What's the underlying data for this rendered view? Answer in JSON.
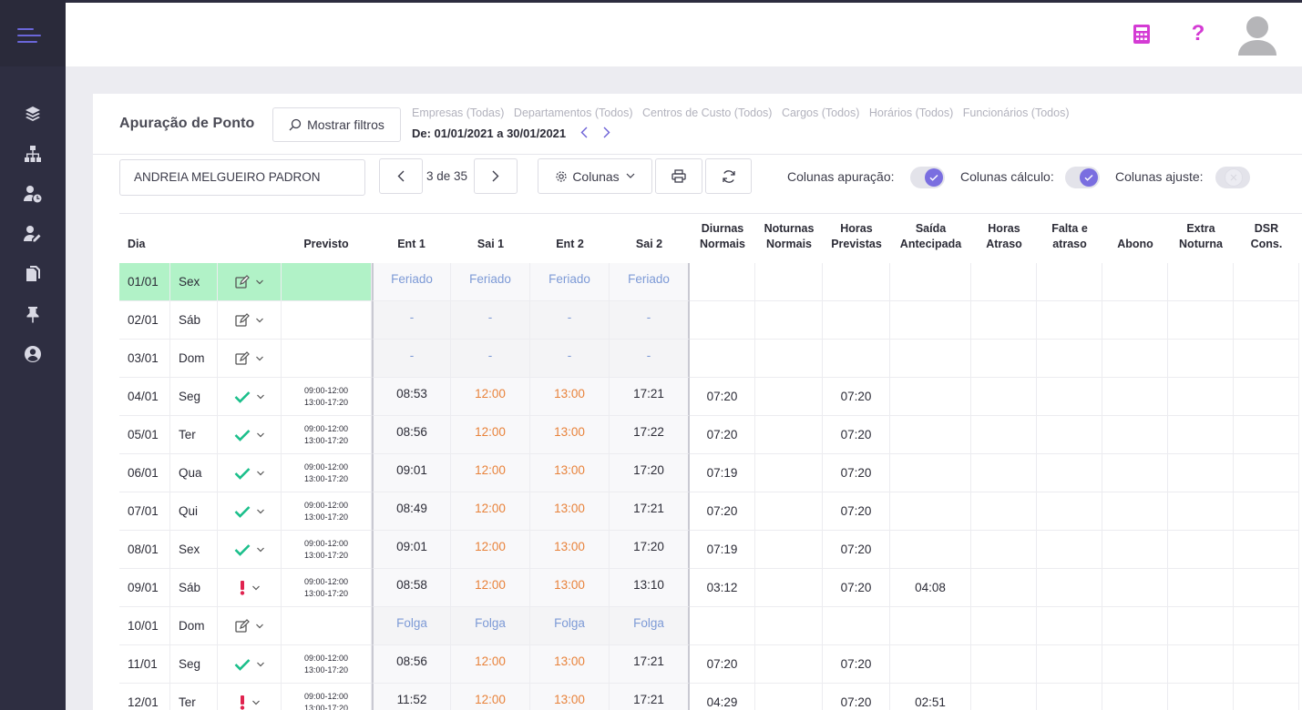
{
  "header": {
    "calculator_icon_color": "#d43bd4",
    "help_icon_color": "#d43bd4",
    "help_label": "?"
  },
  "page": {
    "title": "Apuração de Ponto",
    "show_filters_label": "Mostrar filtros",
    "filters": [
      "Empresas (Todas)",
      "Departamentos (Todos)",
      "Centros de Custo (Todos)",
      "Cargos (Todos)",
      "Horários (Todos)",
      "Funcionários (Todos)"
    ],
    "date_range": "De: 01/01/2021 a 30/01/2021",
    "employee": "ANDREIA MELGUEIRO PADRON",
    "pager": "3 de 35",
    "columns_label": "Colunas",
    "toggles": [
      {
        "label": "Colunas apuração:",
        "on": true
      },
      {
        "label": "Colunas cálculo:",
        "on": true
      },
      {
        "label": "Colunas ajuste:",
        "on": false
      }
    ]
  },
  "colors": {
    "accent": "#7a6ee0",
    "holiday_row": "#b1f2c7",
    "check": "#1bbf8b",
    "alert": "#e0234f",
    "lunch_time": "#e8823a",
    "label_blue": "#7d9ad6"
  },
  "table": {
    "headers": {
      "dia": "Dia",
      "previsto": "Previsto",
      "ent1": "Ent 1",
      "sai1": "Sai 1",
      "ent2": "Ent 2",
      "sai2": "Sai 2",
      "diurnas": [
        "Diurnas",
        "Normais"
      ],
      "noturnas": [
        "Noturnas",
        "Normais"
      ],
      "horas_prev": [
        "Horas",
        "Previstas"
      ],
      "saida_ant": [
        "Saída",
        "Antecipada"
      ],
      "horas_atraso": [
        "Horas",
        "Atraso"
      ],
      "falta": [
        "Falta e",
        "atraso"
      ],
      "abono": "Abono",
      "extra": [
        "Extra",
        "Noturna"
      ],
      "dsr": [
        "DSR",
        "Cons."
      ]
    },
    "rows": [
      {
        "date": "01/01",
        "day": "Sex",
        "status": "edit",
        "previsto": [
          "",
          ""
        ],
        "ent1": "Feriado",
        "sai1": "Feriado",
        "ent2": "Feriado",
        "sai2": "Feriado",
        "kind": "holiday",
        "diurnas": "",
        "horas_prev": "",
        "saida_ant": ""
      },
      {
        "date": "02/01",
        "day": "Sáb",
        "status": "edit",
        "previsto": [
          "",
          ""
        ],
        "ent1": "-",
        "sai1": "-",
        "ent2": "-",
        "sai2": "-",
        "kind": "off",
        "diurnas": "",
        "horas_prev": "",
        "saida_ant": ""
      },
      {
        "date": "03/01",
        "day": "Dom",
        "status": "edit",
        "previsto": [
          "",
          ""
        ],
        "ent1": "-",
        "sai1": "-",
        "ent2": "-",
        "sai2": "-",
        "kind": "off",
        "diurnas": "",
        "horas_prev": "",
        "saida_ant": ""
      },
      {
        "date": "04/01",
        "day": "Seg",
        "status": "check",
        "previsto": [
          "09:00-12:00",
          "13:00-17:20"
        ],
        "ent1": "08:53",
        "sai1": "12:00",
        "ent2": "13:00",
        "sai2": "17:21",
        "kind": "work",
        "diurnas": "07:20",
        "horas_prev": "07:20",
        "saida_ant": ""
      },
      {
        "date": "05/01",
        "day": "Ter",
        "status": "check",
        "previsto": [
          "09:00-12:00",
          "13:00-17:20"
        ],
        "ent1": "08:56",
        "sai1": "12:00",
        "ent2": "13:00",
        "sai2": "17:22",
        "kind": "work",
        "diurnas": "07:20",
        "horas_prev": "07:20",
        "saida_ant": ""
      },
      {
        "date": "06/01",
        "day": "Qua",
        "status": "check",
        "previsto": [
          "09:00-12:00",
          "13:00-17:20"
        ],
        "ent1": "09:01",
        "sai1": "12:00",
        "ent2": "13:00",
        "sai2": "17:20",
        "kind": "work",
        "diurnas": "07:19",
        "horas_prev": "07:20",
        "saida_ant": ""
      },
      {
        "date": "07/01",
        "day": "Qui",
        "status": "check",
        "previsto": [
          "09:00-12:00",
          "13:00-17:20"
        ],
        "ent1": "08:49",
        "sai1": "12:00",
        "ent2": "13:00",
        "sai2": "17:21",
        "kind": "work",
        "diurnas": "07:20",
        "horas_prev": "07:20",
        "saida_ant": ""
      },
      {
        "date": "08/01",
        "day": "Sex",
        "status": "check",
        "previsto": [
          "09:00-12:00",
          "13:00-17:20"
        ],
        "ent1": "09:01",
        "sai1": "12:00",
        "ent2": "13:00",
        "sai2": "17:20",
        "kind": "work",
        "diurnas": "07:19",
        "horas_prev": "07:20",
        "saida_ant": ""
      },
      {
        "date": "09/01",
        "day": "Sáb",
        "status": "alert",
        "previsto": [
          "09:00-12:00",
          "13:00-17:20"
        ],
        "ent1": "08:58",
        "sai1": "12:00",
        "ent2": "13:00",
        "sai2": "13:10",
        "kind": "work",
        "diurnas": "03:12",
        "horas_prev": "07:20",
        "saida_ant": "04:08"
      },
      {
        "date": "10/01",
        "day": "Dom",
        "status": "edit",
        "previsto": [
          "",
          ""
        ],
        "ent1": "Folga",
        "sai1": "Folga",
        "ent2": "Folga",
        "sai2": "Folga",
        "kind": "folga",
        "diurnas": "",
        "horas_prev": "",
        "saida_ant": ""
      },
      {
        "date": "11/01",
        "day": "Seg",
        "status": "check",
        "previsto": [
          "09:00-12:00",
          "13:00-17:20"
        ],
        "ent1": "08:56",
        "sai1": "12:00",
        "ent2": "13:00",
        "sai2": "17:21",
        "kind": "work",
        "diurnas": "07:20",
        "horas_prev": "07:20",
        "saida_ant": ""
      },
      {
        "date": "12/01",
        "day": "Ter",
        "status": "alert",
        "previsto": [
          "09:00-12:00",
          "13:00-17:20"
        ],
        "ent1": "11:52",
        "sai1": "12:00",
        "ent2": "13:00",
        "sai2": "17:21",
        "kind": "work",
        "diurnas": "04:29",
        "horas_prev": "07:20",
        "saida_ant": "02:51"
      }
    ]
  }
}
